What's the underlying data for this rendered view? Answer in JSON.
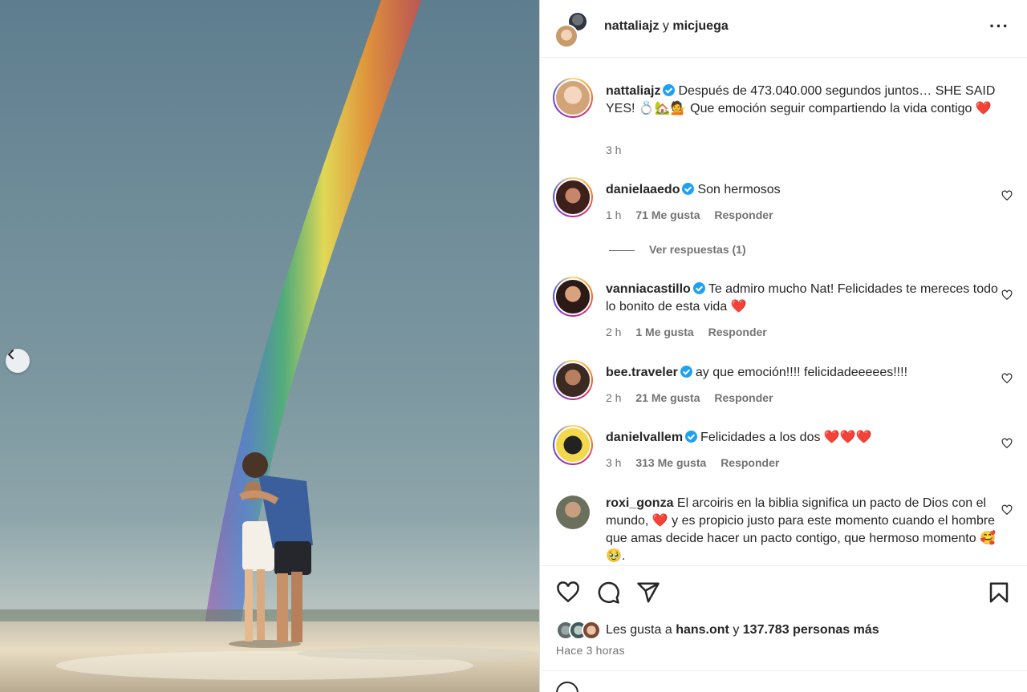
{
  "header": {
    "user1": "nattaliajz",
    "conj": "y",
    "user2": "micjuega",
    "more_icon": "more-horizontal-icon"
  },
  "caption": {
    "user": "nattaliajz",
    "text": "Después de 473.040.000 segundos juntos… SHE SAID YES! 💍🏡💁 Que emoción seguir compartiendo la vida contigo ❤️",
    "time": "3 h"
  },
  "comments": [
    {
      "user": "danielaaedo",
      "text": "Son hermosos",
      "time": "1 h",
      "likes": "71 Me gusta",
      "reply": "Responder"
    },
    {
      "user": "vanniacastillo",
      "text": "Te admiro mucho Nat! Felicidades te mereces todo lo bonito de esta vida ❤️",
      "time": "2 h",
      "likes": "1 Me gusta",
      "reply": "Responder"
    },
    {
      "user": "bee.traveler",
      "text": "ay que emoción!!!! felicidadeeeees!!!!",
      "time": "2 h",
      "likes": "21 Me gusta",
      "reply": "Responder"
    },
    {
      "user": "danielvallem",
      "text": "Felicidades a los dos ❤️❤️❤️",
      "time": "3 h",
      "likes": "313 Me gusta",
      "reply": "Responder"
    },
    {
      "user": "roxi_gonza",
      "text": "El arcoiris en la biblia significa un pacto de Dios con el mundo, ❤️ y es propicio justo para este momento cuando el hombre que amas decide hacer un pacto contigo, que hermoso momento 🥰🥹."
    }
  ],
  "replies_toggle": "Ver respuestas (1)",
  "actions": {
    "like_icon": "heart-icon",
    "comment_icon": "comment-icon",
    "share_icon": "send-icon",
    "save_icon": "bookmark-icon"
  },
  "likes": {
    "prefix": "Les gusta a",
    "user": "hans.ont",
    "conj": "y",
    "count": "137.783 personas más"
  },
  "time_ago": "Hace 3 horas",
  "colors": {
    "verified": "#1da1f2",
    "text": "#262626",
    "secondary": "#737373"
  }
}
